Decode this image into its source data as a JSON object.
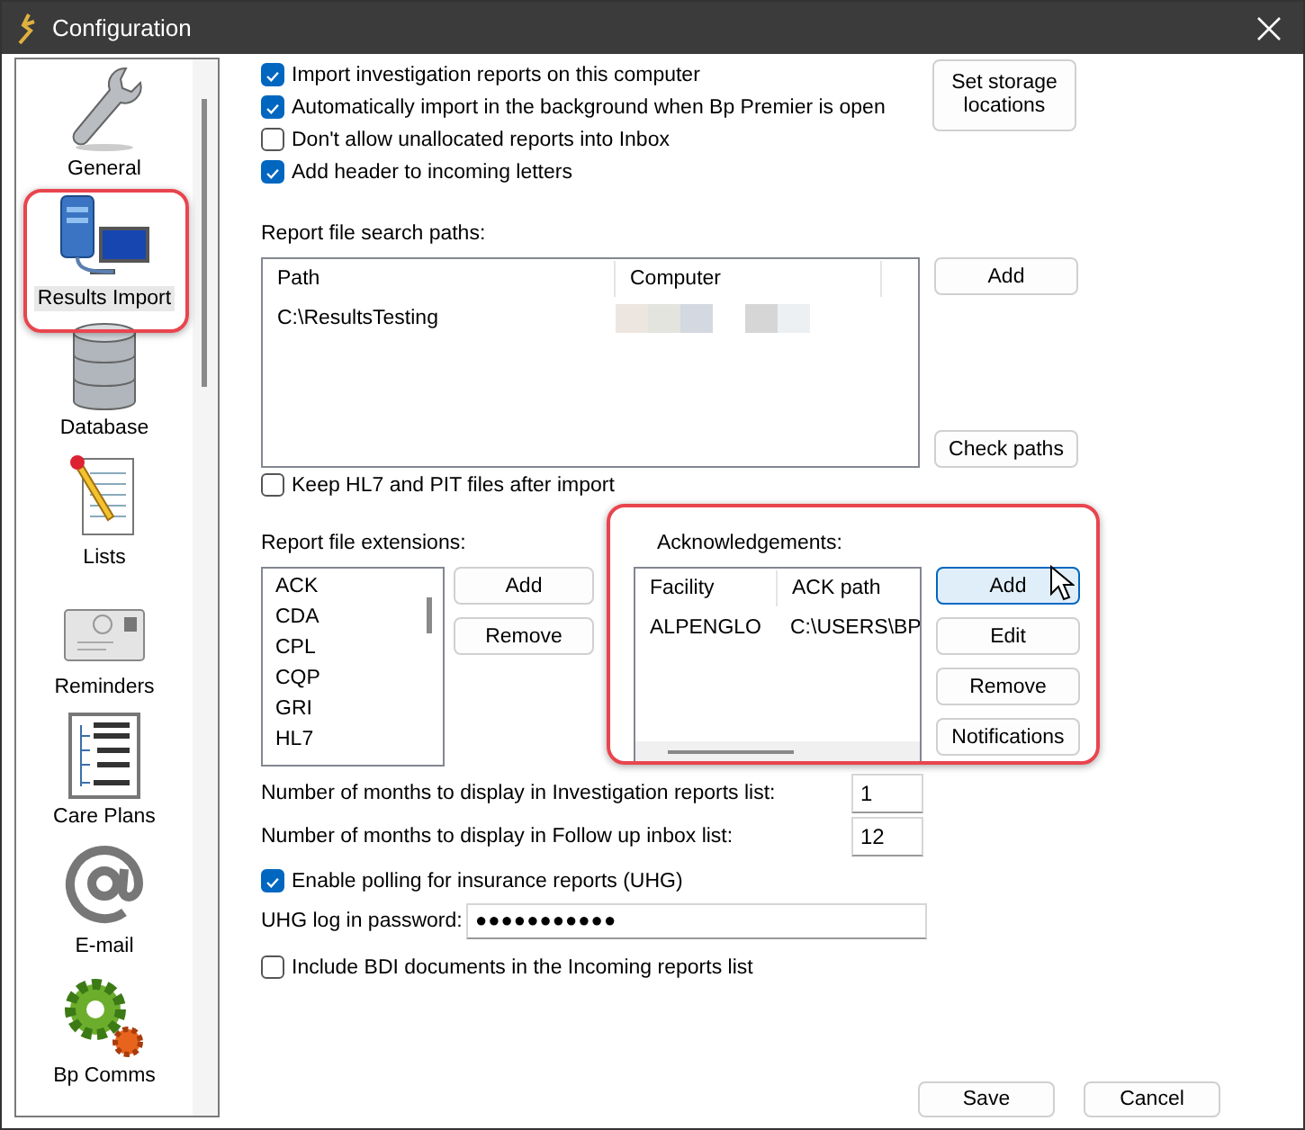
{
  "window": {
    "title": "Configuration"
  },
  "sidebar": {
    "items": [
      {
        "label": "General",
        "kind": "wrench",
        "selected": false
      },
      {
        "label": "Results Import",
        "kind": "network",
        "selected": true
      },
      {
        "label": "Database",
        "kind": "database",
        "selected": false
      },
      {
        "label": "Lists",
        "kind": "notepad",
        "selected": false
      },
      {
        "label": "Reminders",
        "kind": "envelope",
        "selected": false
      },
      {
        "label": "Care Plans",
        "kind": "tree",
        "selected": false
      },
      {
        "label": "E-mail",
        "kind": "at",
        "selected": false
      },
      {
        "label": "Bp Comms",
        "kind": "gear",
        "selected": false
      }
    ]
  },
  "import_options": [
    {
      "label": "Import investigation reports on this computer",
      "checked": true
    },
    {
      "label": "Automatically import in the background when Bp Premier is open",
      "checked": true
    },
    {
      "label": "Don't allow unallocated reports into Inbox",
      "checked": false
    },
    {
      "label": "Add header to incoming letters",
      "checked": true
    }
  ],
  "storage_button": "Set storage locations",
  "search_paths": {
    "label": "Report file search paths:",
    "columns": [
      "Path",
      "Computer"
    ],
    "rows": [
      {
        "path": "C:\\ResultsTesting",
        "computer_redacted": true
      }
    ],
    "buttons": [
      "Add",
      "Check paths"
    ]
  },
  "keep_files": {
    "label": "Keep HL7 and PIT files after import",
    "checked": false
  },
  "extensions": {
    "label": "Report file extensions:",
    "items": [
      "ACK",
      "CDA",
      "CPL",
      "CQP",
      "GRI",
      "HL7"
    ],
    "buttons": [
      "Add",
      "Remove"
    ]
  },
  "acknowledgements": {
    "label": "Acknowledgements:",
    "columns": [
      "Facility",
      "ACK path"
    ],
    "rows": [
      {
        "facility": "ALPENGLO",
        "ack_path": "C:\\USERS\\BP"
      }
    ],
    "buttons": [
      {
        "label": "Add",
        "hovered": true
      },
      {
        "label": "Edit",
        "hovered": false
      },
      {
        "label": "Remove",
        "hovered": false
      },
      {
        "label": "Notifications",
        "hovered": false
      }
    ]
  },
  "months": [
    {
      "label": "Number of months to display in Investigation reports list:",
      "value": "1"
    },
    {
      "label": "Number of months to display in Follow up inbox list:",
      "value": "12"
    }
  ],
  "polling": {
    "label": "Enable polling for insurance reports (UHG)",
    "checked": true
  },
  "password": {
    "label": "UHG log in password:",
    "value": "●●●●●●●●●●●"
  },
  "bdi": {
    "label": "Include BDI documents in the Incoming reports list",
    "checked": false
  },
  "footer_buttons": [
    "Save",
    "Cancel"
  ]
}
